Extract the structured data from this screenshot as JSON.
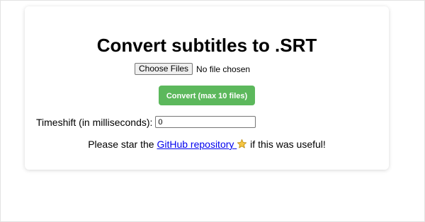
{
  "page": {
    "title": "Convert subtitles to .SRT"
  },
  "file_input": {
    "button_label": "Choose Files",
    "status_text": "No file chosen"
  },
  "convert": {
    "label": "Convert (max 10 files)",
    "color": "#5cb85c"
  },
  "timeshift": {
    "label": "Timeshift (in milliseconds):",
    "value": "0"
  },
  "footer": {
    "prefix": "Please star the ",
    "link_text": "GitHub repository",
    "star_icon": "star-icon",
    "suffix": " if this was useful!"
  },
  "colors": {
    "link": "#0000ee",
    "star_fill": "#f5c542"
  }
}
